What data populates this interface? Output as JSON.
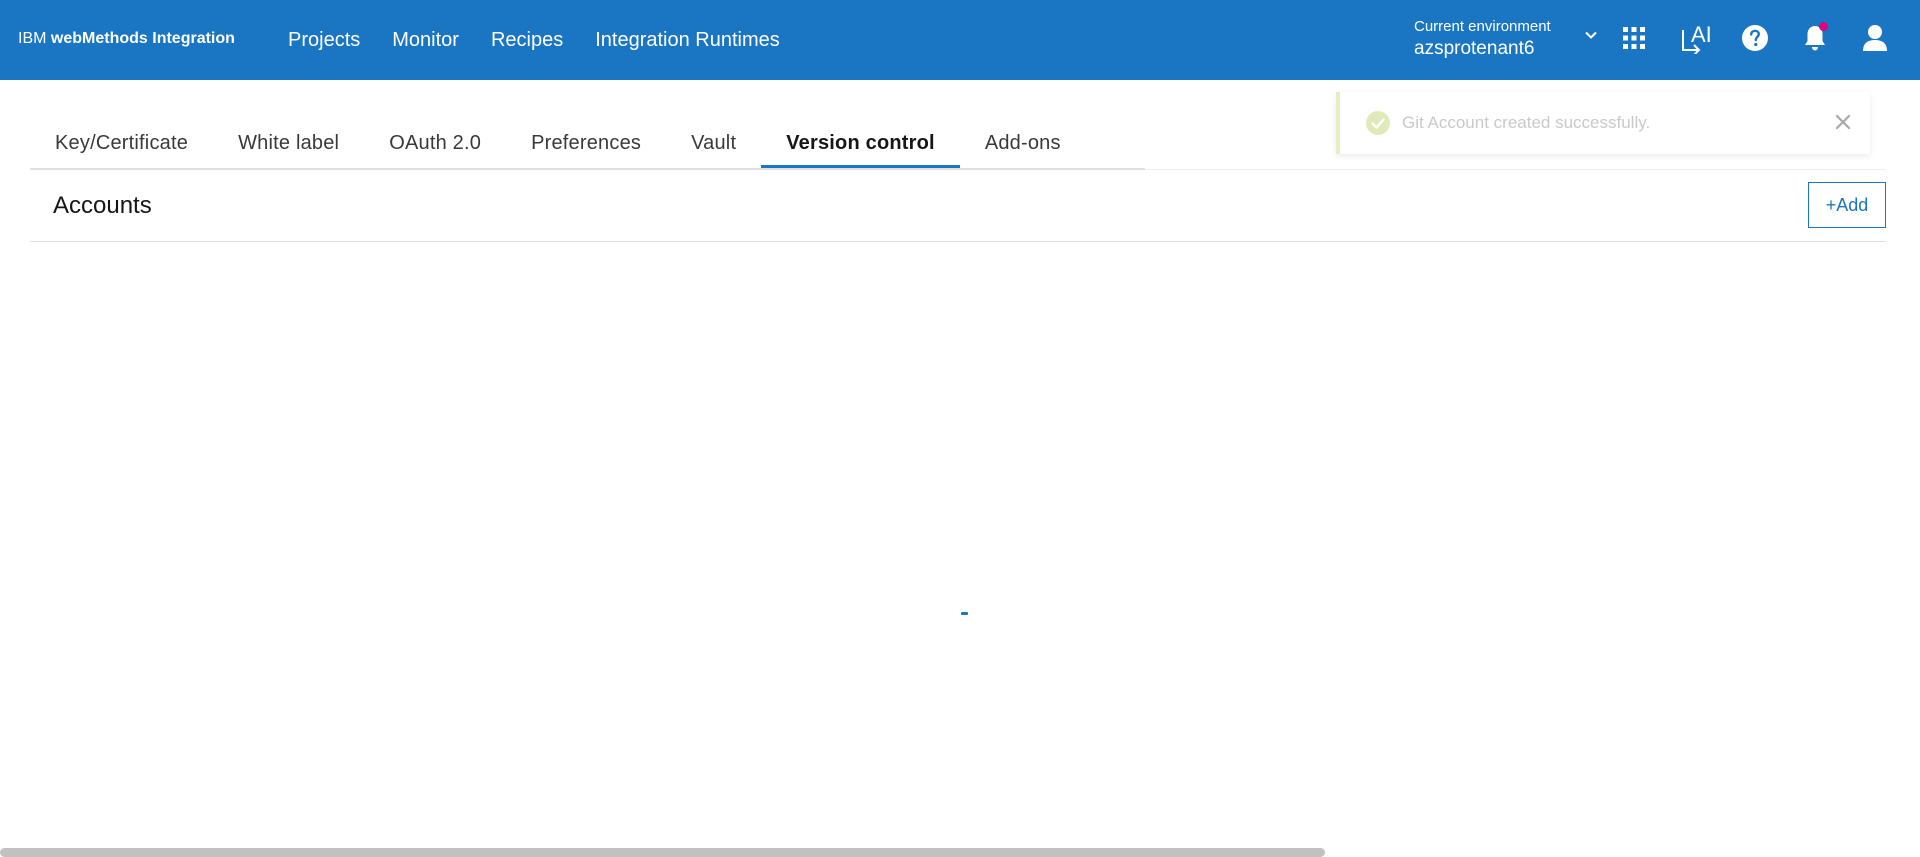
{
  "header": {
    "brand_prefix": "IBM",
    "brand_name": "webMethods Integration",
    "nav": [
      {
        "label": "Projects"
      },
      {
        "label": "Monitor"
      },
      {
        "label": "Recipes"
      },
      {
        "label": "Integration Runtimes"
      }
    ],
    "environment": {
      "label": "Current environment",
      "value": "azsprotenant6"
    },
    "icons": [
      "apps-grid-icon",
      "ai-assistant-icon",
      "help-icon",
      "notification-bell-icon",
      "user-profile-icon"
    ],
    "ai_label": "AI"
  },
  "tabs": [
    {
      "label": "Key/Certificate",
      "active": false
    },
    {
      "label": "White label",
      "active": false
    },
    {
      "label": "OAuth 2.0",
      "active": false
    },
    {
      "label": "Preferences",
      "active": false
    },
    {
      "label": "Vault",
      "active": false
    },
    {
      "label": "Version control",
      "active": true
    },
    {
      "label": "Add-ons",
      "active": false
    }
  ],
  "toast": {
    "message": "Git Account created successfully.",
    "icon": "checkmark-circle-icon",
    "close_icon": "close-icon"
  },
  "accounts": {
    "title": "Accounts",
    "add_label": "+Add"
  },
  "colors": {
    "header_bg": "#1a75c2",
    "accent": "#1a75c2",
    "toast_border": "#e5eec4",
    "toast_icon": "#dfeab8",
    "notification_dot": "#e0007e"
  }
}
